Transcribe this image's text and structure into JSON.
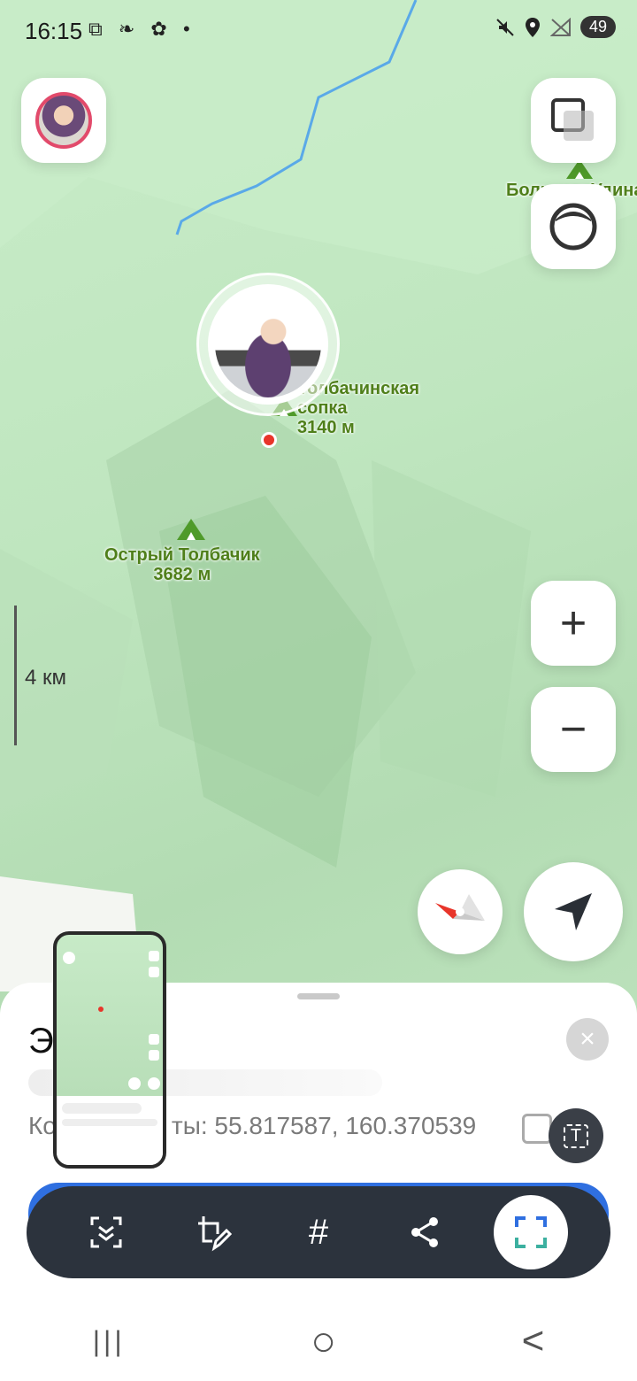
{
  "status_bar": {
    "time": "16:15",
    "left_icons": [
      "screenshot-icon",
      "leaf-icon",
      "fan-icon",
      "dot-icon"
    ],
    "right_icons": [
      "mute-icon",
      "location-icon",
      "no-signal-icon"
    ],
    "battery": "49"
  },
  "map": {
    "labels": [
      {
        "name": "Большая Удина"
      },
      {
        "name": "Плоская Толбачинская сопка",
        "line1": "Толбачинская",
        "line2": "сопка",
        "elevation": "3140 м"
      },
      {
        "name": "Острый Толбачик",
        "line1": "Острый Толбачик",
        "elevation": "3682 м"
      }
    ],
    "scale": "4 км",
    "river_color": "#5aa9e8",
    "label_color": "#4f7f1a"
  },
  "controls": {
    "zoom_in": "+",
    "zoom_out": "−"
  },
  "sheet": {
    "title_visible": "Э",
    "coords_prefix": "Ко",
    "coords_rest": "ты: 55.817587, 160.370539",
    "close": "×",
    "ocr_label": "T"
  },
  "toolbar": {
    "tools": [
      "scroll-capture-icon",
      "edit-crop-icon",
      "hashtag-icon",
      "share-icon",
      "smart-select-icon"
    ],
    "hashtag": "#"
  },
  "navbar": {
    "recent": "|||",
    "home": "○",
    "back": "<"
  },
  "colors": {
    "accent_blue": "#2f6fe0",
    "pin_red": "#e8352a",
    "toolbar_dark": "#2c333d"
  }
}
